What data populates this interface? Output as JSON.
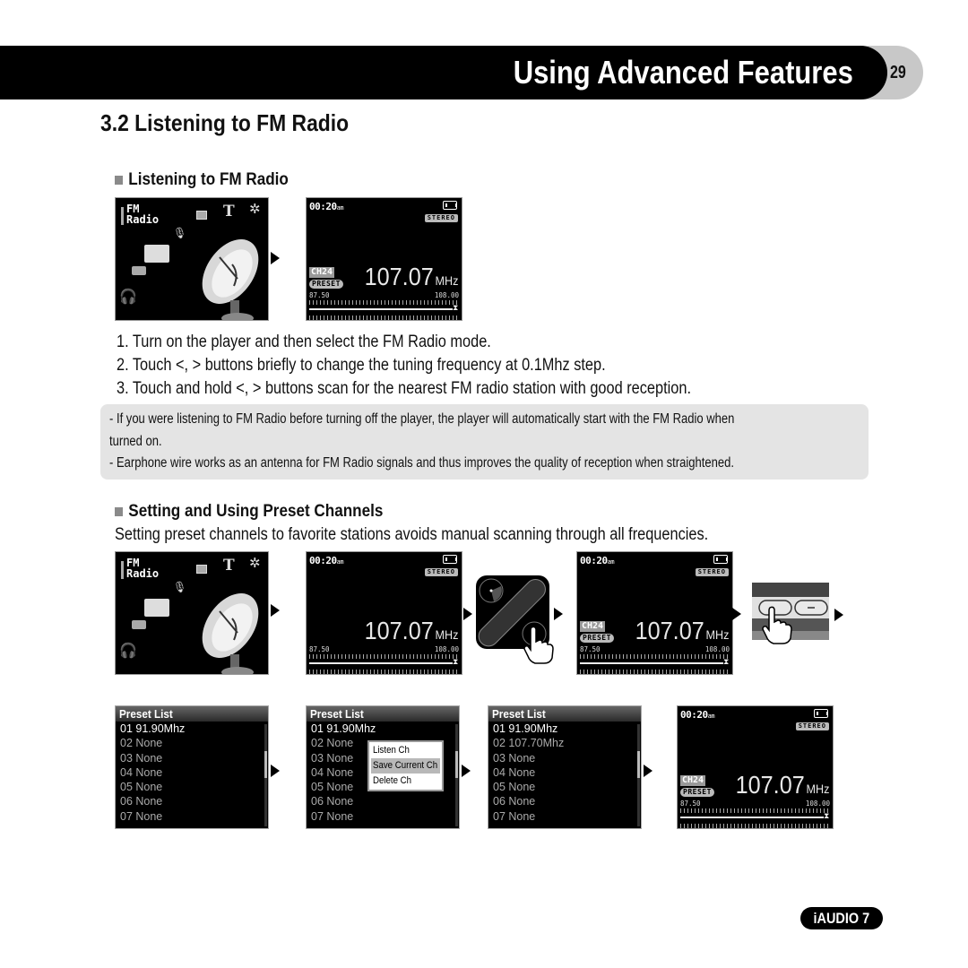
{
  "header": {
    "chapter_title": "Using Advanced Features",
    "page_number": "29"
  },
  "section": {
    "title": "3.2 Listening to FM Radio"
  },
  "listening": {
    "heading": "Listening to FM Radio",
    "steps": [
      "1. Turn on the player and then select the FM Radio mode.",
      "2. Touch <, > buttons briefly to change the tuning frequency at 0.1Mhz step.",
      "3. Touch and hold <, > buttons scan for the nearest FM radio station with good reception."
    ],
    "notes": [
      "-  If you were listening to FM Radio before turning off the player, the player will automatically start with the FM Radio when",
      "turned on.",
      "- Earphone wire works as an antenna for FM Radio signals and thus improves the quality of reception when straightened."
    ]
  },
  "preset": {
    "heading": "Setting and Using Preset Channels",
    "description": "Setting preset channels to favorite stations avoids manual scanning through all frequencies."
  },
  "menu_screen": {
    "label_line1": "FM",
    "label_line2": "Radio",
    "icons": [
      "photo-icon",
      "text-icon",
      "settings-gear-icon",
      "microphone-icon",
      "radio-icon",
      "video-camera-icon",
      "headphones-icon",
      "satellite-dish-icon"
    ]
  },
  "radio_screen": {
    "time": "00:20",
    "ampm": "am",
    "stereo": "STEREO",
    "channel": "CH24",
    "preset_badge": "PRESET",
    "frequency": "107.07",
    "unit": "MHz",
    "range_min": "87.50",
    "range_max": "108.00",
    "tuning_position": 0.98
  },
  "preset_lists": [
    {
      "title": "Preset List",
      "rows": [
        "01  91.90Mhz",
        "02  None",
        "03  None",
        "04  None",
        "05  None",
        "06  None",
        "07  None"
      ]
    },
    {
      "title": "Preset List",
      "rows": [
        "01  91.90Mhz",
        "02  None",
        "03  None",
        "04  None",
        "05  None",
        "06  None",
        "07  None"
      ],
      "context_menu": [
        "Listen Ch",
        "Save Current Ch",
        "Delete Ch"
      ],
      "context_selected": 1
    },
    {
      "title": "Preset List",
      "rows": [
        "01  91.90Mhz",
        "02  107.70Mhz",
        "03  None",
        "04  None",
        "05  None",
        "06  None",
        "07  None"
      ]
    }
  ],
  "footer": {
    "brand": "iAUDIO 7"
  }
}
